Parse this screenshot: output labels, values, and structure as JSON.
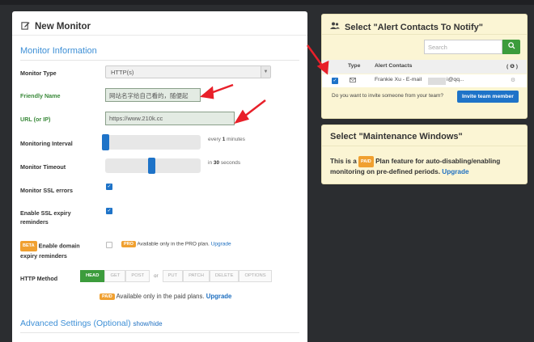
{
  "monitor_panel": {
    "title": "New Monitor",
    "section_title": "Monitor Information",
    "type_label": "Monitor Type",
    "type_value": "HTTP(s)",
    "friendly_label": "Friendly Name",
    "friendly_value": "网站名字给自己看的，随便起",
    "url_label": "URL (or IP)",
    "url_value": "https://www.210k.cc",
    "interval_label": "Monitoring Interval",
    "interval_hint_pre": "every ",
    "interval_hint_value": "1",
    "interval_hint_post": " minutes",
    "timeout_label": "Monitor Timeout",
    "timeout_hint_pre": "in ",
    "timeout_hint_value": "30",
    "timeout_hint_post": " seconds",
    "ssl_label": "Monitor SSL errors",
    "ssl_expiry_label_1": "Enable SSL expiry",
    "ssl_expiry_label_2": "reminders",
    "beta_badge": "BETA",
    "domain_label_1": "Enable domain",
    "domain_label_2": "expiry reminders",
    "pro_badge": "PRO",
    "pro_text": "Available only in the PRO plan.",
    "upgrade": "Upgrade",
    "http_method_label": "HTTP Method",
    "methods_a": [
      "HEAD",
      "GET",
      "POST"
    ],
    "or_text": "or",
    "methods_b": [
      "PUT",
      "PATCH",
      "DELETE",
      "OPTIONS"
    ],
    "paid_badge": "PAID",
    "paid_text": "Available only in the paid plans.",
    "advanced_title": "Advanced Settings (Optional)",
    "advanced_toggle": "show/hide"
  },
  "alert_panel": {
    "title": "Select \"Alert Contacts To Notify\"",
    "search_placeholder": "Search",
    "col_type": "Type",
    "col_contacts": "Alert Contacts",
    "col_action": "( ❶ )",
    "contact": "Frankie Xu - E-mail",
    "contact_suffix": "i@qq...",
    "invite_text": "Do you want to invite someone from your team?",
    "invite_button": "Invite team member"
  },
  "maintenance_panel": {
    "title": "Select \"Maintenance Windows\"",
    "text_pre": "This is a",
    "paid_badge": "PAID",
    "text_post": "Plan feature for auto-disabling/enabling monitoring on pre-defined periods.",
    "upgrade": "Upgrade"
  },
  "colors": {
    "accent_blue": "#1e73c8",
    "green": "#3c9c3c",
    "badge_orange": "#f0a030",
    "arrow_red": "#e8202a",
    "yellow_panel": "#fbf5d4"
  }
}
